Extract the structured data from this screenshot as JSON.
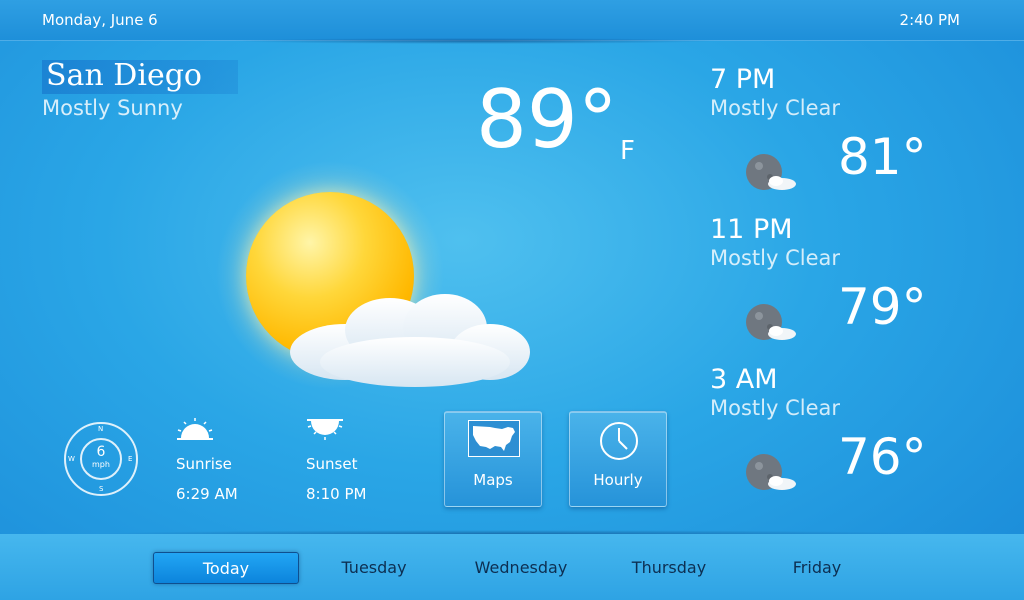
{
  "header": {
    "date": "Monday, June 6",
    "time": "2:40 PM"
  },
  "current": {
    "city": "San Diego",
    "condition": "Mostly Sunny",
    "temperature": "89°",
    "unit": "F",
    "icon": "sun-with-cloud-icon"
  },
  "wind": {
    "speed": "6",
    "unit": "mph",
    "directions": {
      "n": "N",
      "e": "E",
      "s": "S",
      "w": "W"
    }
  },
  "sunrise": {
    "label": "Sunrise",
    "time": "6:29 AM"
  },
  "sunset": {
    "label": "Sunset",
    "time": "8:10 PM"
  },
  "buttons": {
    "maps": {
      "label": "Maps",
      "icon": "us-map-icon"
    },
    "hourly": {
      "label": "Hourly",
      "icon": "clock-icon"
    }
  },
  "forecast": [
    {
      "time": "7 PM",
      "condition": "Mostly Clear",
      "temp": "81°",
      "icon": "moon-cloud-icon"
    },
    {
      "time": "11 PM",
      "condition": "Mostly Clear",
      "temp": "79°",
      "icon": "moon-cloud-icon"
    },
    {
      "time": "3 AM",
      "condition": "Mostly Clear",
      "temp": "76°",
      "icon": "moon-cloud-icon"
    }
  ],
  "days": [
    "Today",
    "Tuesday",
    "Wednesday",
    "Thursday",
    "Friday"
  ],
  "active_day": "Today",
  "colors": {
    "accent": "#1a8ad8",
    "active_tab": "#0c84dc",
    "tab_text": "#0d2f52",
    "sun": "#ffc21a"
  }
}
